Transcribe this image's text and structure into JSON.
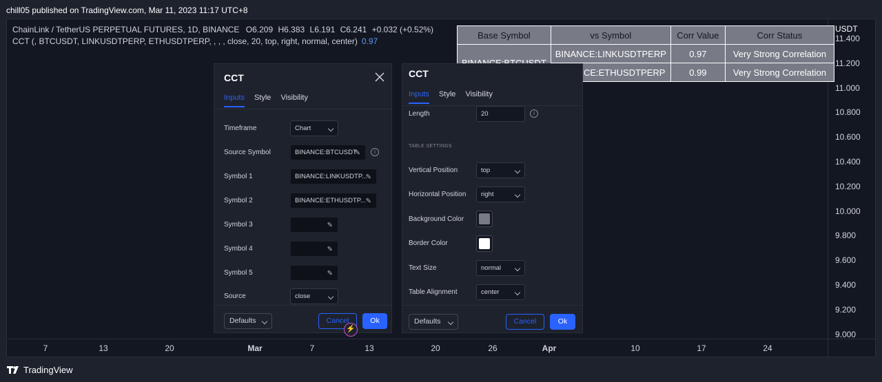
{
  "header": {
    "published": "chill05 published on TradingView.com, Mar 11, 2023 11:17 UTC+8"
  },
  "legend": {
    "symbol": "ChainLink / TetherUS PERPETUAL FUTURES, 1D, BINANCE",
    "o_label": "O",
    "o_value": "6.209",
    "h_label": "H",
    "h_value": "6.383",
    "l_label": "L",
    "l_value": "6.191",
    "c_label": "C",
    "c_value": "6.241",
    "change": "+0.032 (+0.52%)",
    "indicator": "CCT (, BTCUSDT, LINKUSDTPERP, ETHUSDTPERP, , , , close, 20, top, right, normal, center)",
    "indicator_value": "0.97"
  },
  "price_axis": {
    "unit": "USDT",
    "ticks": [
      "11.400",
      "11.200",
      "11.000",
      "10.800",
      "10.600",
      "10.400",
      "10.200",
      "10.000",
      "9.800",
      "9.600",
      "9.400",
      "9.200",
      "9.000"
    ]
  },
  "time_axis": {
    "ticks": [
      "7",
      "13",
      "20",
      "Mar",
      "7",
      "13",
      "20",
      "26",
      "Apr",
      "10",
      "17",
      "24"
    ]
  },
  "corr_table": {
    "headers": [
      "Base Symbol",
      "vs Symbol",
      "Corr Value",
      "Corr Status"
    ],
    "base_symbol": "BINANCE:BTCUSDT",
    "rows": [
      {
        "vs": "BINANCE:LINKUSDTPERP",
        "value": "0.97",
        "status": "Very Strong Correlation"
      },
      {
        "vs": "BINANCE:ETHUSDTPERP",
        "value": "0.99",
        "status": "Very Strong Correlation"
      }
    ]
  },
  "dialog_left": {
    "title": "CCT",
    "tabs": [
      "Inputs",
      "Style",
      "Visibility"
    ],
    "fields": {
      "timeframe_label": "Timeframe",
      "timeframe_value": "Chart",
      "source_symbol_label": "Source Symbol",
      "source_symbol_value": "BINANCE:BTCUSDT",
      "symbol1_label": "Symbol 1",
      "symbol1_value": "BINANCE:LINKUSDTP...",
      "symbol2_label": "Symbol 2",
      "symbol2_value": "BINANCE:ETHUSDTP...",
      "symbol3_label": "Symbol 3",
      "symbol4_label": "Symbol 4",
      "symbol5_label": "Symbol 5",
      "source_label": "Source",
      "source_value": "close"
    },
    "defaults": "Defaults",
    "cancel": "Cancel",
    "ok": "Ok"
  },
  "dialog_right": {
    "title": "CCT",
    "tabs": [
      "Inputs",
      "Style",
      "Visibility"
    ],
    "fields": {
      "length_label": "Length",
      "length_value": "20",
      "section": "TABLE SETTINGS",
      "vpos_label": "Vertical Position",
      "vpos_value": "top",
      "hpos_label": "Horizontal Position",
      "hpos_value": "right",
      "bg_label": "Background Color",
      "bg_color": "#787b86",
      "border_label": "Border Color",
      "border_color": "#ffffff",
      "text_size_label": "Text Size",
      "text_size_value": "normal",
      "align_label": "Table Alignment",
      "align_value": "center"
    },
    "defaults": "Defaults",
    "cancel": "Cancel",
    "ok": "Ok"
  },
  "footer": {
    "brand": "TradingView"
  },
  "colors": {
    "accent": "#2962ff",
    "background": "#131722",
    "panel": "#1e222d",
    "table_bg": "#787b86"
  }
}
